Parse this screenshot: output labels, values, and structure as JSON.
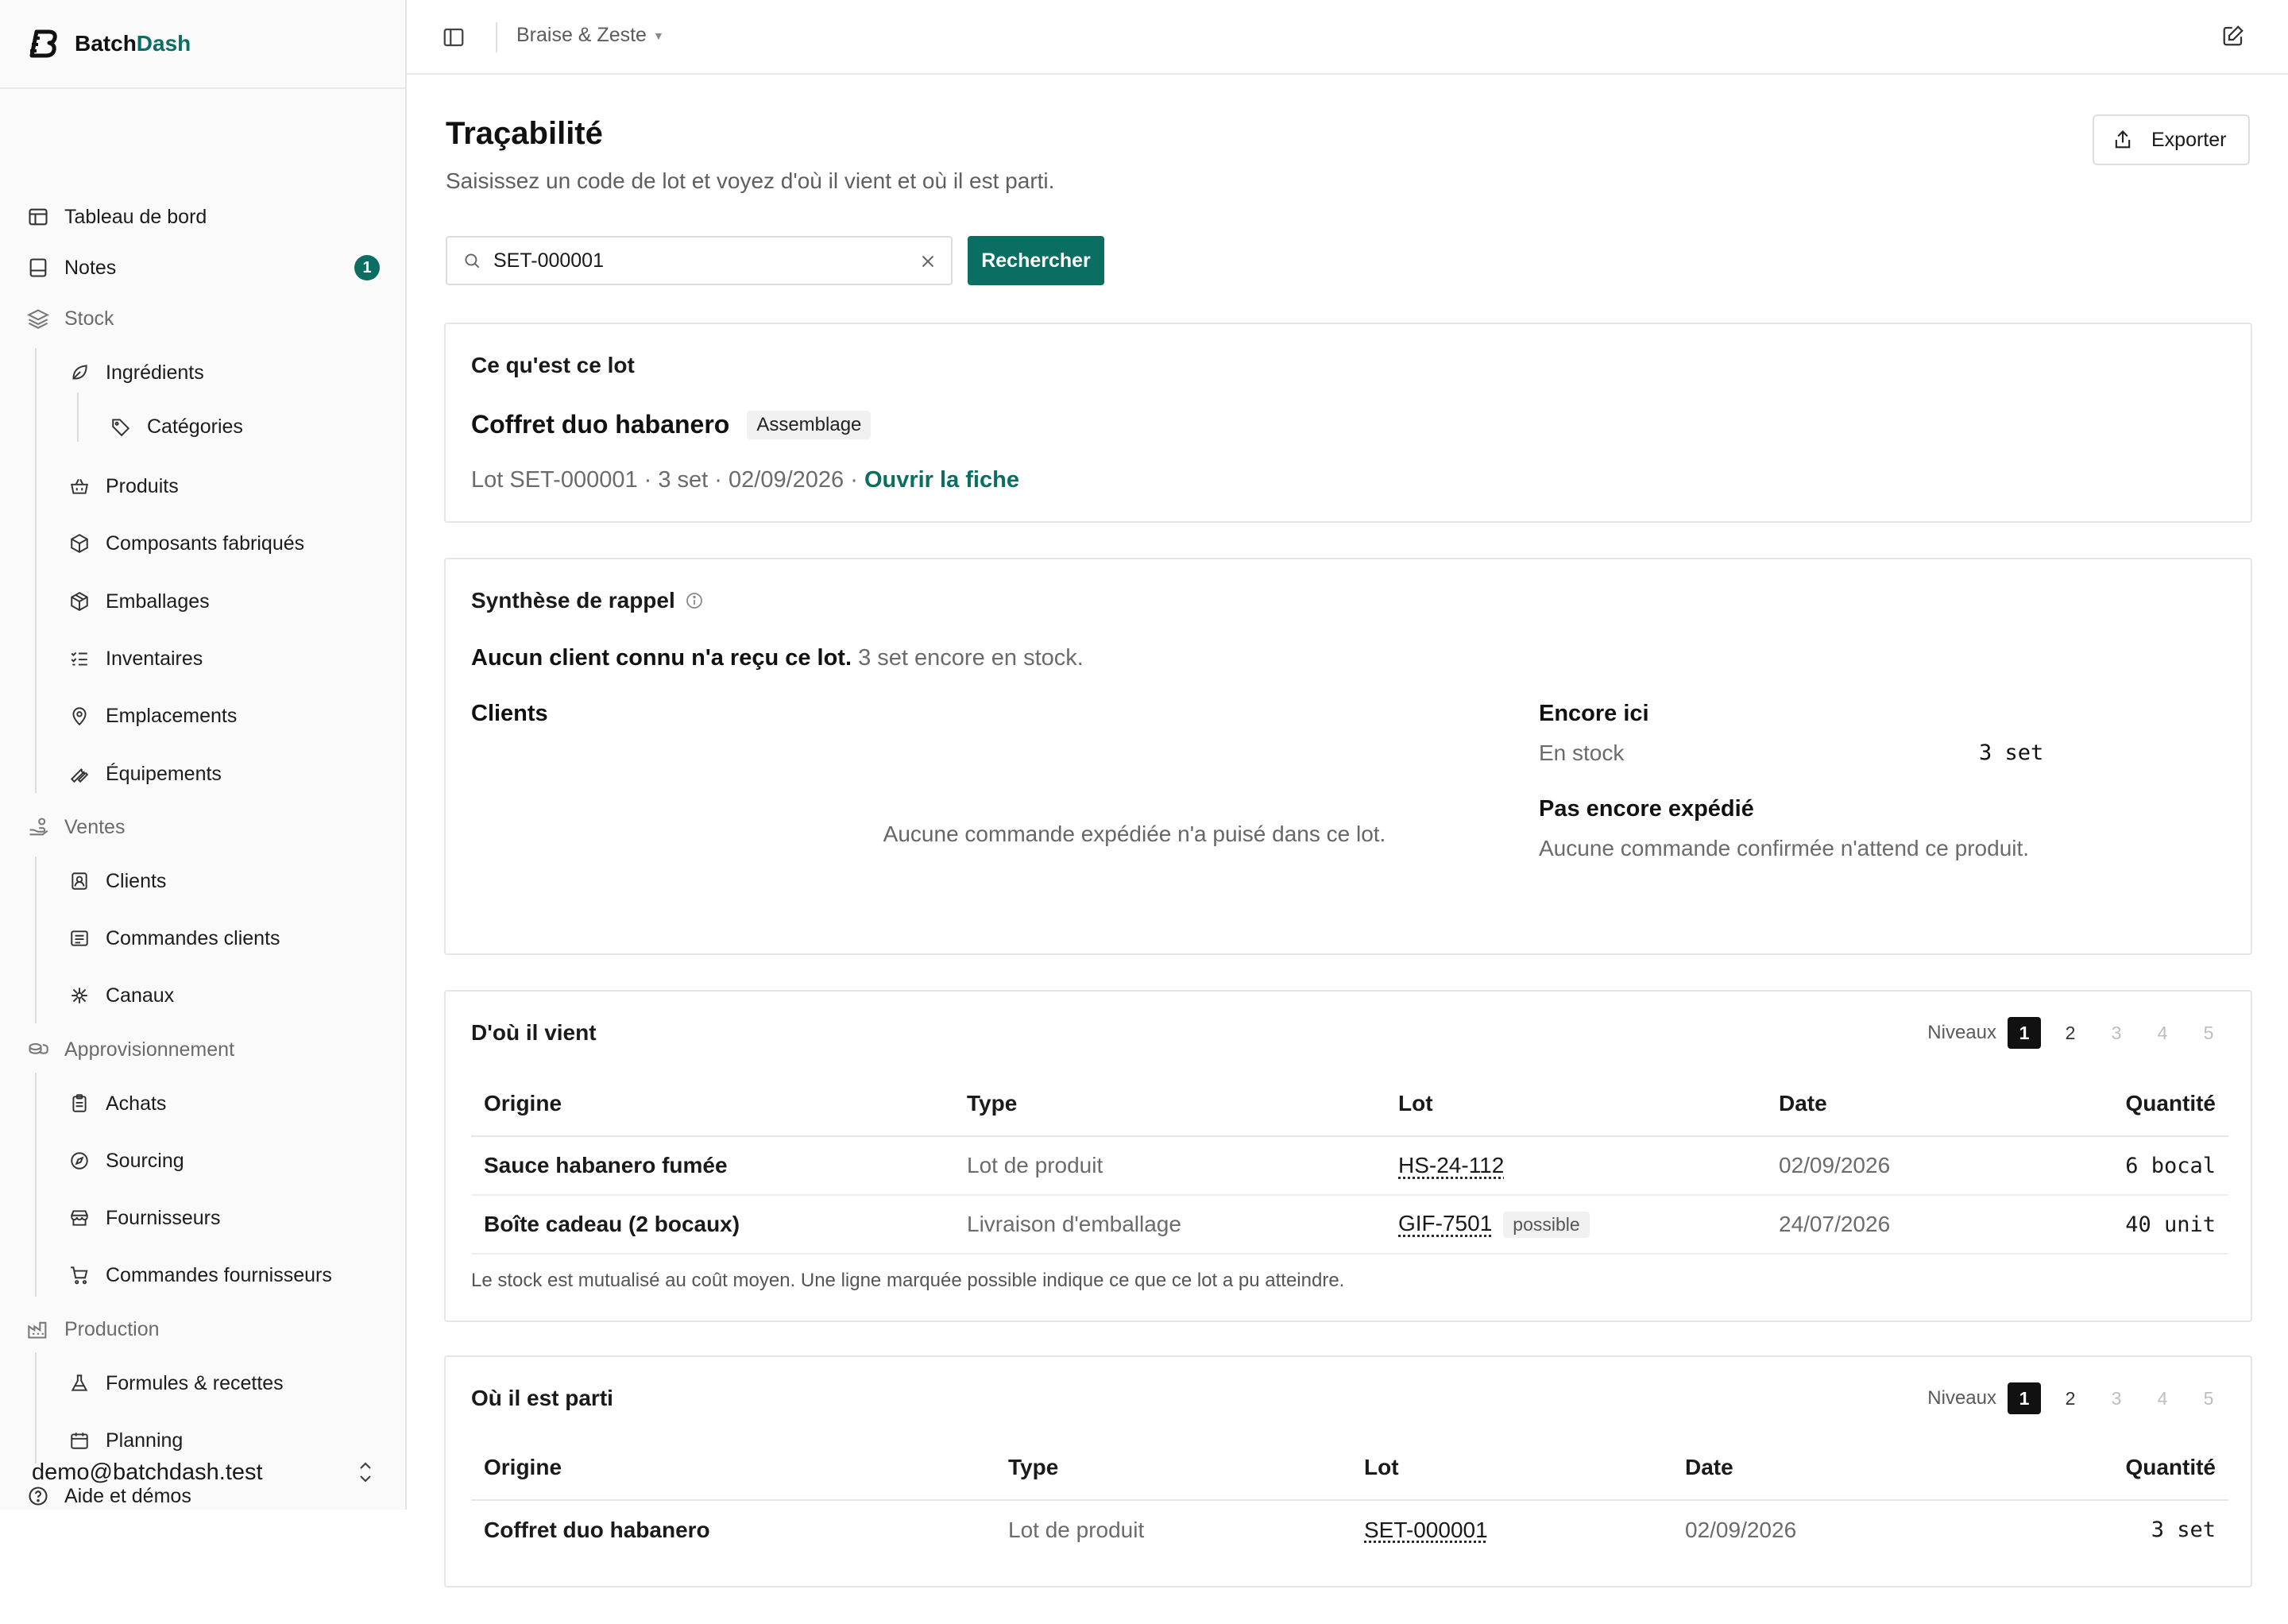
{
  "brand": {
    "name_part1": "Batch",
    "name_part2": "Dash",
    "accent": "#0b6e63"
  },
  "sidebar": {
    "items": [
      {
        "key": "dashboard",
        "label": "Tableau de bord",
        "icon": "layout-dashboard-icon"
      },
      {
        "key": "notes",
        "label": "Notes",
        "icon": "notes-icon",
        "badge": "1"
      },
      {
        "key": "stock",
        "label": "Stock",
        "icon": "layers-icon",
        "group": true
      },
      {
        "key": "ingredients",
        "label": "Ingrédients",
        "icon": "leaf-icon"
      },
      {
        "key": "categories",
        "label": "Catégories",
        "icon": "tag-icon"
      },
      {
        "key": "produits",
        "label": "Produits",
        "icon": "basket-icon"
      },
      {
        "key": "composants",
        "label": "Composants fabriqués",
        "icon": "box-icon"
      },
      {
        "key": "emballages",
        "label": "Emballages",
        "icon": "package-icon"
      },
      {
        "key": "inventaires",
        "label": "Inventaires",
        "icon": "list-checks-icon"
      },
      {
        "key": "emplacements",
        "label": "Emplacements",
        "icon": "map-pin-icon"
      },
      {
        "key": "equipements",
        "label": "Équipements",
        "icon": "wrench-icon"
      },
      {
        "key": "ventes",
        "label": "Ventes",
        "icon": "hand-coins-icon",
        "group": true
      },
      {
        "key": "clients",
        "label": "Clients",
        "icon": "contact-icon"
      },
      {
        "key": "commandes_clients",
        "label": "Commandes clients",
        "icon": "receipt-icon"
      },
      {
        "key": "canaux",
        "label": "Canaux",
        "icon": "network-icon"
      },
      {
        "key": "approvisionnement",
        "label": "Approvisionnement",
        "icon": "coins-icon",
        "group": true
      },
      {
        "key": "achats",
        "label": "Achats",
        "icon": "clipboard-icon"
      },
      {
        "key": "sourcing",
        "label": "Sourcing",
        "icon": "compass-icon"
      },
      {
        "key": "fournisseurs",
        "label": "Fournisseurs",
        "icon": "store-icon"
      },
      {
        "key": "commandes_fournisseurs",
        "label": "Commandes fournisseurs",
        "icon": "cart-icon"
      },
      {
        "key": "production",
        "label": "Production",
        "icon": "factory-icon",
        "group": true
      },
      {
        "key": "formules",
        "label": "Formules & recettes",
        "icon": "flask-icon"
      },
      {
        "key": "planning",
        "label": "Planning",
        "icon": "calendar-icon"
      },
      {
        "key": "aide",
        "label": "Aide et démos",
        "icon": "help-circle-icon"
      }
    ],
    "user_email": "demo@batchdash.test"
  },
  "topbar": {
    "workspace": "Braise & Zeste"
  },
  "page": {
    "title": "Traçabilité",
    "subtitle": "Saisissez un code de lot et voyez d'où il vient et où il est parti.",
    "export_label": "Exporter"
  },
  "search": {
    "value": "SET-000001",
    "button_label": "Rechercher"
  },
  "lot_card": {
    "title": "Ce qu'est ce lot",
    "product_name": "Coffret duo habanero",
    "kind_pill": "Assemblage",
    "meta": "Lot SET-000001 · 3 set · 02/09/2026 · ",
    "open_link": "Ouvrir la fiche"
  },
  "recall": {
    "title": "Synthèse de rappel",
    "summary_bold": "Aucun client connu n'a reçu ce lot.",
    "summary_rest": "3 set encore en stock.",
    "clients_title": "Clients",
    "clients_empty": "Aucune commande expédiée n'a puisé dans ce lot.",
    "here_title": "Encore ici",
    "here_label": "En stock",
    "here_value": "3 set",
    "pending_title": "Pas encore expédié",
    "pending_text": "Aucune commande confirmée n'attend ce produit."
  },
  "upstream": {
    "title": "D'où il vient",
    "levels_label": "Niveaux",
    "levels": [
      "1",
      "2",
      "3",
      "4",
      "5"
    ],
    "columns": [
      "Origine",
      "Type",
      "Lot",
      "Date",
      "Quantité"
    ],
    "rows": [
      {
        "origin": "Sauce habanero fumée",
        "type": "Lot de produit",
        "lot": "HS-24-112",
        "tag": "",
        "date": "02/09/2026",
        "qty": "6 bocal"
      },
      {
        "origin": "Boîte cadeau (2 bocaux)",
        "type": "Livraison d'emballage",
        "lot": "GIF-7501",
        "tag": "possible",
        "date": "24/07/2026",
        "qty": "40 unit"
      }
    ],
    "note": "Le stock est mutualisé au coût moyen. Une ligne marquée possible indique ce que ce lot a pu atteindre."
  },
  "downstream": {
    "title": "Où il est parti",
    "levels_label": "Niveaux",
    "levels": [
      "1",
      "2",
      "3",
      "4",
      "5"
    ],
    "columns": [
      "Origine",
      "Type",
      "Lot",
      "Date",
      "Quantité"
    ],
    "rows": [
      {
        "origin": "Coffret duo habanero",
        "type": "Lot de produit",
        "lot": "SET-000001",
        "date": "02/09/2026",
        "qty": "3 set"
      }
    ]
  }
}
